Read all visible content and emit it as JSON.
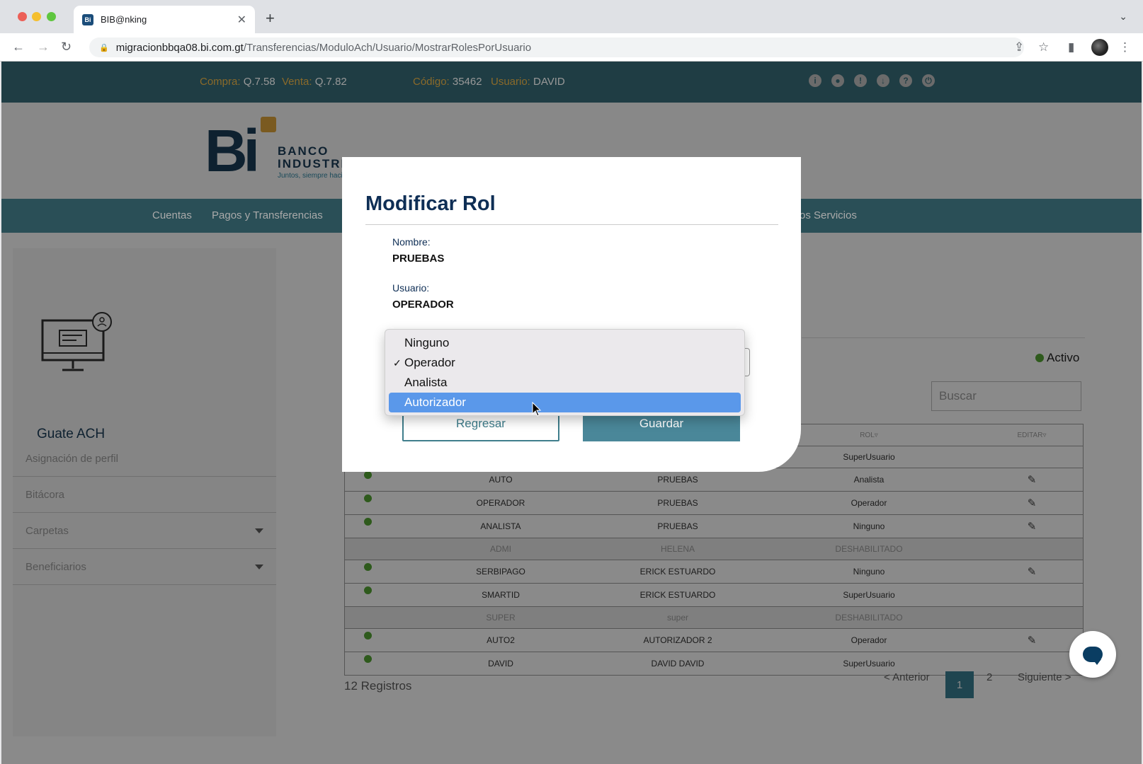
{
  "browser": {
    "tab_title": "BIB@nking",
    "favicon_text": "Bi",
    "url_host": "migracionbbqa08.bi.com.gt",
    "url_path": "/Transferencias/ModuloAch/Usuario/MostrarRolesPorUsuario"
  },
  "topbar": {
    "compra_label": "Compra:",
    "compra_value": "Q.7.58",
    "venta_label": "Venta:",
    "venta_value": "Q.7.82",
    "codigo_label": "Código:",
    "codigo_value": "35462",
    "usuario_label": "Usuario:",
    "usuario_value": "DAVID"
  },
  "brand": {
    "logo_mark": "Bi",
    "name_line1": "BANCO",
    "name_line2": "INDUSTRIAL",
    "tagline": "Juntos, siempre hacia"
  },
  "mainnav": {
    "items": [
      "Cuentas",
      "Pagos y Transferencias",
      "os Servicios"
    ]
  },
  "sidebar": {
    "title": "Guate ACH",
    "items": [
      "Asignación de perfil",
      "Bitácora",
      "Carpetas",
      "Beneficiarios"
    ]
  },
  "content": {
    "status_label": "Activo",
    "search_placeholder": "Buscar",
    "columns": {
      "rol": "ROL▿",
      "editar": "EDITAR▿"
    },
    "rows": [
      {
        "user": "",
        "name": "",
        "rol": "SuperUsuario",
        "active": false,
        "editable": false,
        "disabled": false
      },
      {
        "user": "AUTO",
        "name": "PRUEBAS",
        "rol": "Analista",
        "active": true,
        "editable": true,
        "disabled": false
      },
      {
        "user": "OPERADOR",
        "name": "PRUEBAS",
        "rol": "Operador",
        "active": true,
        "editable": true,
        "disabled": false
      },
      {
        "user": "ANALISTA",
        "name": "PRUEBAS",
        "rol": "Ninguno",
        "active": true,
        "editable": true,
        "disabled": false
      },
      {
        "user": "ADMI",
        "name": "HELENA",
        "rol": "DESHABILITADO",
        "active": false,
        "editable": false,
        "disabled": true
      },
      {
        "user": "SERBIPAGO",
        "name": "ERICK ESTUARDO",
        "rol": "Ninguno",
        "active": true,
        "editable": true,
        "disabled": false
      },
      {
        "user": "SMARTID",
        "name": "ERICK ESTUARDO",
        "rol": "SuperUsuario",
        "active": true,
        "editable": false,
        "disabled": false
      },
      {
        "user": "SUPER",
        "name": "super",
        "rol": "DESHABILITADO",
        "active": false,
        "editable": false,
        "disabled": true
      },
      {
        "user": "AUTO2",
        "name": "AUTORIZADOR 2",
        "rol": "Operador",
        "active": true,
        "editable": true,
        "disabled": false
      },
      {
        "user": "DAVID",
        "name": "DAVID DAVID",
        "rol": "SuperUsuario",
        "active": true,
        "editable": false,
        "disabled": false
      }
    ],
    "records": "12 Registros",
    "pager": {
      "prev": "< Anterior",
      "page1": "1",
      "page2": "2",
      "next": "Siguiente >"
    }
  },
  "modal": {
    "title": "Modificar Rol",
    "nombre_label": "Nombre:",
    "nombre_value": "PRUEBAS",
    "usuario_label": "Usuario:",
    "usuario_value": "OPERADOR",
    "regresar_label": "Regresar",
    "guardar_label": "Guardar"
  },
  "dropdown": {
    "options": [
      "Ninguno",
      "Operador",
      "Analista",
      "Autorizador"
    ],
    "checked": "Operador",
    "highlighted": "Autorizador",
    "check_mark": "✓"
  },
  "colors": {
    "topbar": "#1f3d44",
    "nav": "#2a4f57",
    "accent": "#4a8799",
    "highlight": "#5a98ea",
    "title": "#0e2e55"
  }
}
